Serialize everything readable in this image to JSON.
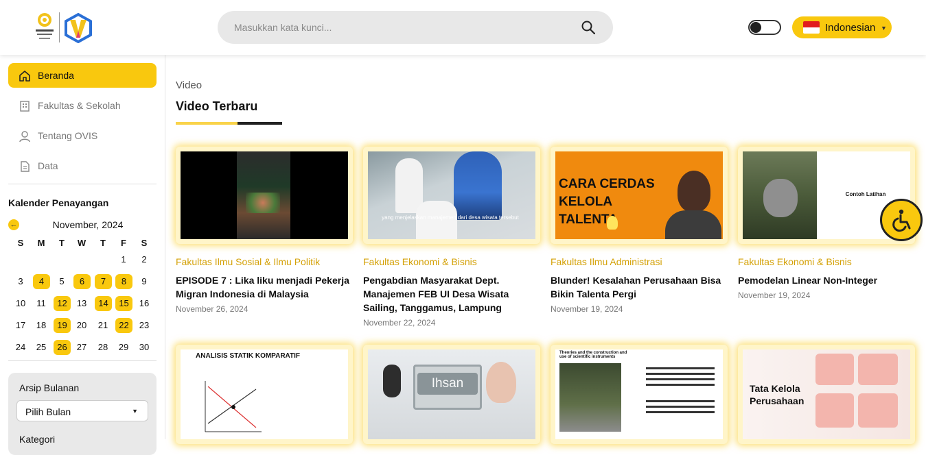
{
  "header": {
    "search_placeholder": "Masukkan kata kunci...",
    "language": "Indonesian",
    "colors": {
      "accent": "#f9c80e",
      "search_bg": "#e8e8e8"
    }
  },
  "sidebar": {
    "nav": [
      {
        "label": "Beranda",
        "icon": "home-icon",
        "active": true
      },
      {
        "label": "Fakultas & Sekolah",
        "icon": "building-icon",
        "active": false
      },
      {
        "label": "Tentang OVIS",
        "icon": "user-icon",
        "active": false
      },
      {
        "label": "Data",
        "icon": "document-icon",
        "active": false
      }
    ],
    "calendar": {
      "title": "Kalender Penayangan",
      "month": "November, 2024",
      "weekdays": [
        "S",
        "M",
        "T",
        "W",
        "T",
        "F",
        "S"
      ],
      "days": [
        "1",
        "2",
        "3",
        "4",
        "5",
        "6",
        "7",
        "8",
        "9",
        "10",
        "11",
        "12",
        "13",
        "14",
        "15",
        "16",
        "17",
        "18",
        "19",
        "20",
        "21",
        "22",
        "23",
        "24",
        "25",
        "26",
        "27",
        "28",
        "29",
        "30"
      ],
      "highlighted": [
        "4",
        "6",
        "7",
        "8",
        "12",
        "14",
        "15",
        "19",
        "22",
        "26"
      ]
    },
    "archive": {
      "title": "Arsip Bulanan",
      "select_value": "Pilih Bulan",
      "next_title": "Kategori"
    }
  },
  "main": {
    "breadcrumb": "Video",
    "title": "Video Terbaru",
    "videos": [
      {
        "faculty": "Fakultas Ilmu Sosial & Ilmu Politik",
        "title": "EPISODE 7 : Lika liku menjadi Pekerja Migran Indonesia di Malaysia",
        "date": "November 26, 2024"
      },
      {
        "faculty": "Fakultas Ekonomi & Bisnis",
        "title": "Pengabdian Masyarakat Dept. Manajemen FEB UI Desa Wisata Sailing, Tanggamus, Lampung",
        "date": "November 22, 2024",
        "thumb_caption": "yang menjelaskan manajemen dari desa wisata tersebut"
      },
      {
        "faculty": "Fakultas Ilmu Administrasi",
        "title": "Blunder! Kesalahan Perusahaan Bisa Bikin Talenta Pergi",
        "date": "November 19, 2024",
        "thumb_text": "CARA CERDAS KELOLA TALENTA"
      },
      {
        "faculty": "Fakultas Ekonomi & Bisnis",
        "title": "Pemodelan Linear Non-Integer",
        "date": "November 19, 2024",
        "thumb_text": "Contoh Latihan"
      }
    ],
    "row2_thumbs": [
      {
        "text": "ANALISIS STATIK KOMPARATIF"
      },
      {
        "text": "Ihsan"
      },
      {
        "text": "Theories and the construction and use of scientific instruments"
      },
      {
        "text": "Tata Kelola Perusahaan"
      }
    ]
  }
}
